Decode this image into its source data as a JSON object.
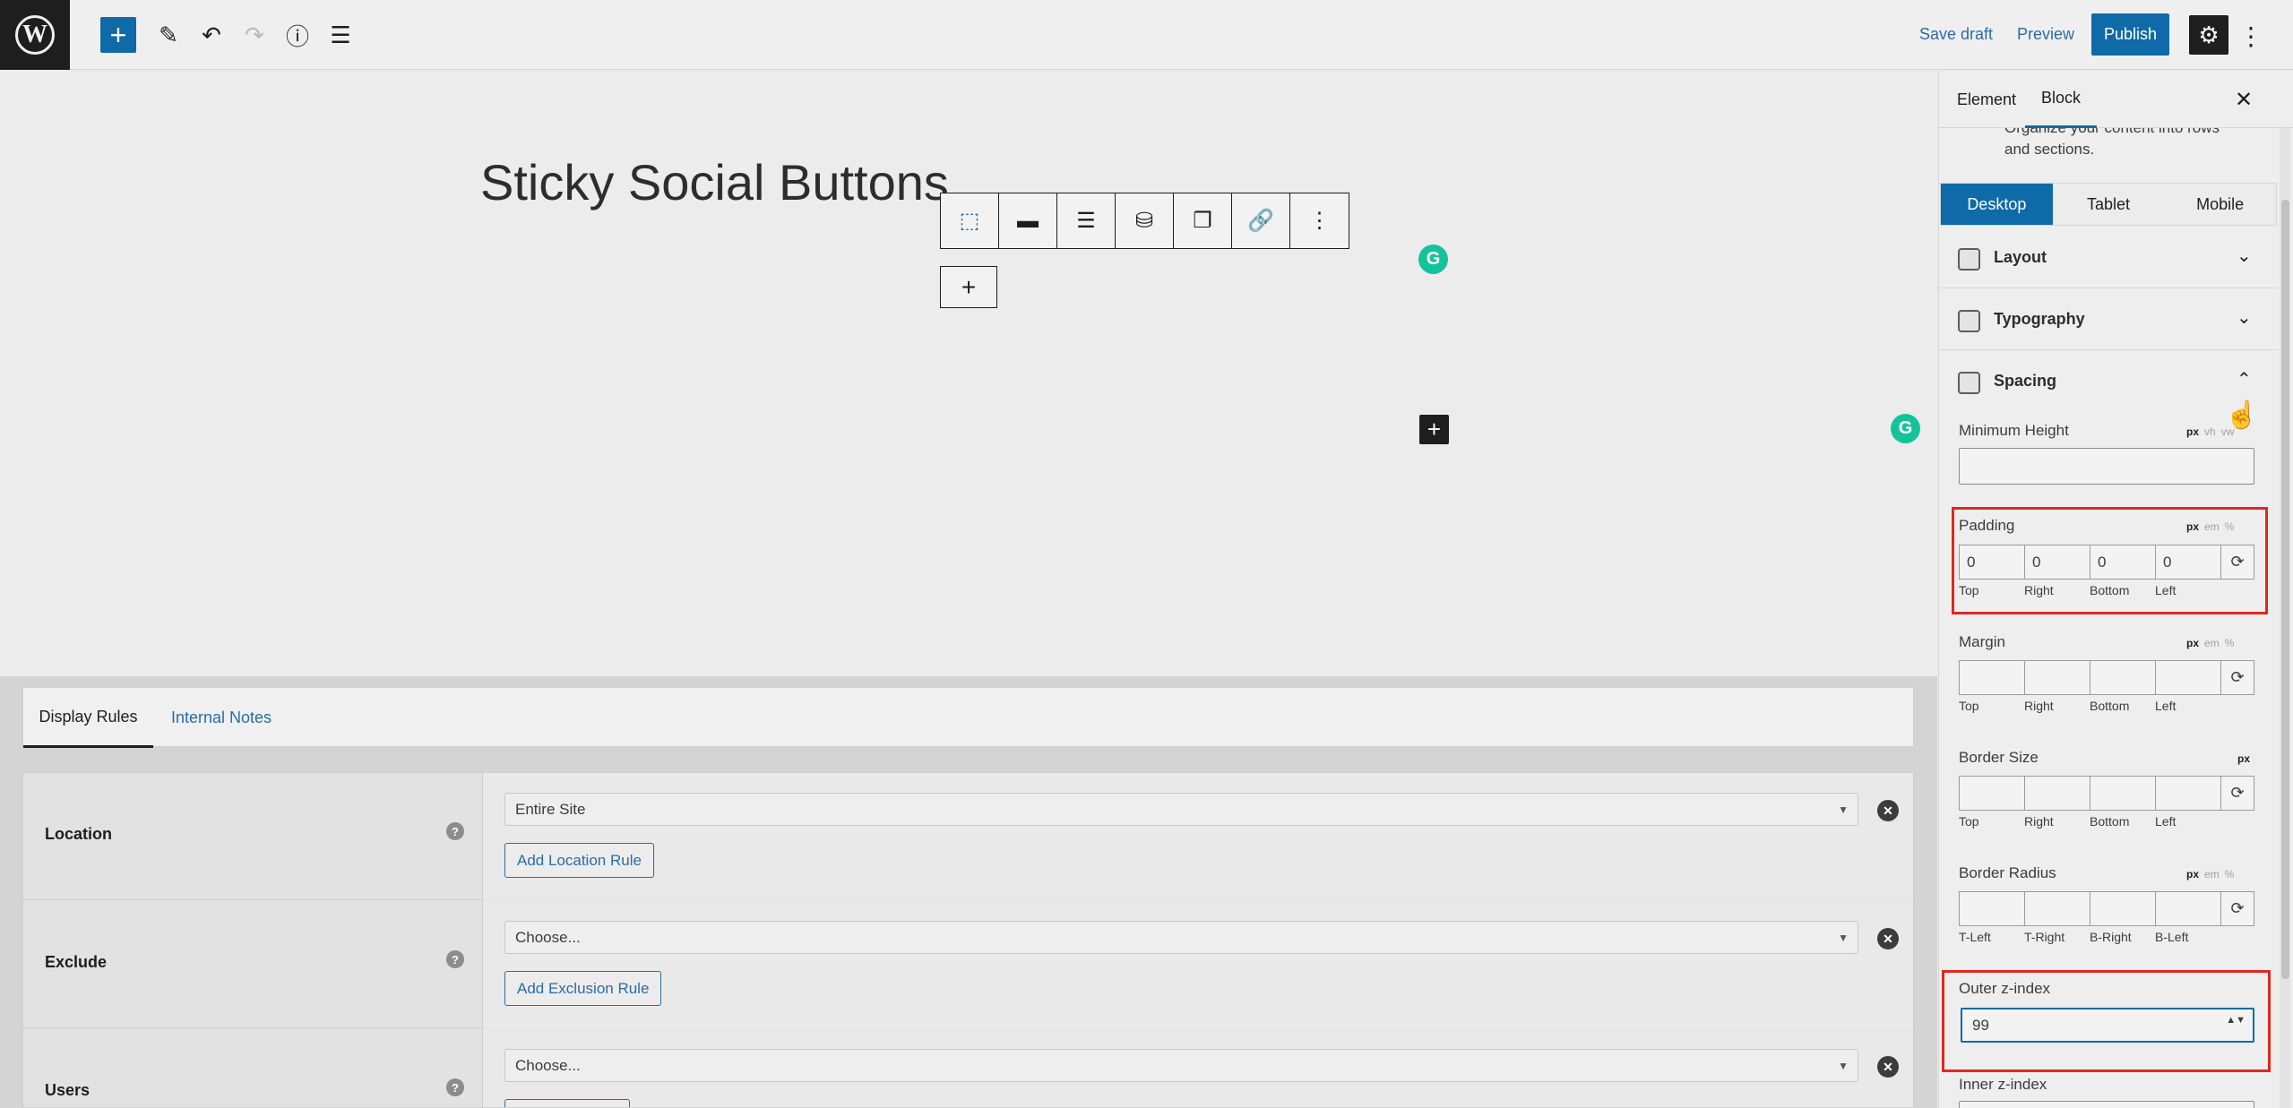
{
  "topbar": {
    "logo_letter": "W",
    "icons": {
      "add": "+",
      "edit": "✎",
      "undo": "↶",
      "redo": "↷",
      "info": "ⓘ",
      "list": "☰"
    },
    "save_draft": "Save draft",
    "preview": "Preview",
    "publish": "Publish",
    "settings_icon": "⚙",
    "more_icon": "⋮"
  },
  "canvas": {
    "title": "Sticky Social Buttons",
    "block_toolbar": [
      "⬚",
      "▬",
      "☰",
      "⛁",
      "❐",
      "🔗",
      "⋮"
    ],
    "appender": "+",
    "grammarly_letter": "G",
    "dark_appender": "+"
  },
  "meta": {
    "tabs": [
      "Display Rules",
      "Internal Notes"
    ],
    "rows": [
      {
        "label": "Location",
        "select": "Entire Site",
        "button": "Add Location Rule"
      },
      {
        "label": "Exclude",
        "select": "Choose...",
        "button": "Add Exclusion Rule"
      },
      {
        "label": "Users",
        "select": "Choose...",
        "button": ""
      }
    ],
    "help": "?",
    "clear": "✕",
    "caret": "▼"
  },
  "sidebar": {
    "tabs": {
      "element": "Element",
      "block": "Block"
    },
    "close": "✕",
    "description": "Organize your content into rows and sections.",
    "devices": [
      "Desktop",
      "Tablet",
      "Mobile"
    ],
    "panels": {
      "layout": "Layout",
      "typography": "Typography",
      "spacing": "Spacing"
    },
    "chevron_down": "⌄",
    "chevron_up": "⌃",
    "min_height": {
      "label": "Minimum Height",
      "units": [
        "px",
        "vh",
        "vw"
      ]
    },
    "padding": {
      "label": "Padding",
      "units": [
        "px",
        "em",
        "%"
      ],
      "values": [
        "0",
        "0",
        "0",
        "0"
      ],
      "sides": [
        "Top",
        "Right",
        "Bottom",
        "Left"
      ]
    },
    "margin": {
      "label": "Margin",
      "units": [
        "px",
        "em",
        "%"
      ],
      "sides": [
        "Top",
        "Right",
        "Bottom",
        "Left"
      ]
    },
    "border_size": {
      "label": "Border Size",
      "units": [
        "px"
      ],
      "sides": [
        "Top",
        "Right",
        "Bottom",
        "Left"
      ]
    },
    "border_radius": {
      "label": "Border Radius",
      "units": [
        "px",
        "em",
        "%"
      ],
      "sides": [
        "T-Left",
        "T-Right",
        "B-Right",
        "B-Left"
      ]
    },
    "outer_z": {
      "label": "Outer z-index",
      "value": "99"
    },
    "inner_z": {
      "label": "Inner z-index"
    },
    "sync_icon": "⟳",
    "spin_icon": "▲▼"
  },
  "colors": {
    "accent": "#0f6aa8",
    "highlight": "#e0281e",
    "grammarly": "#15c39a"
  }
}
